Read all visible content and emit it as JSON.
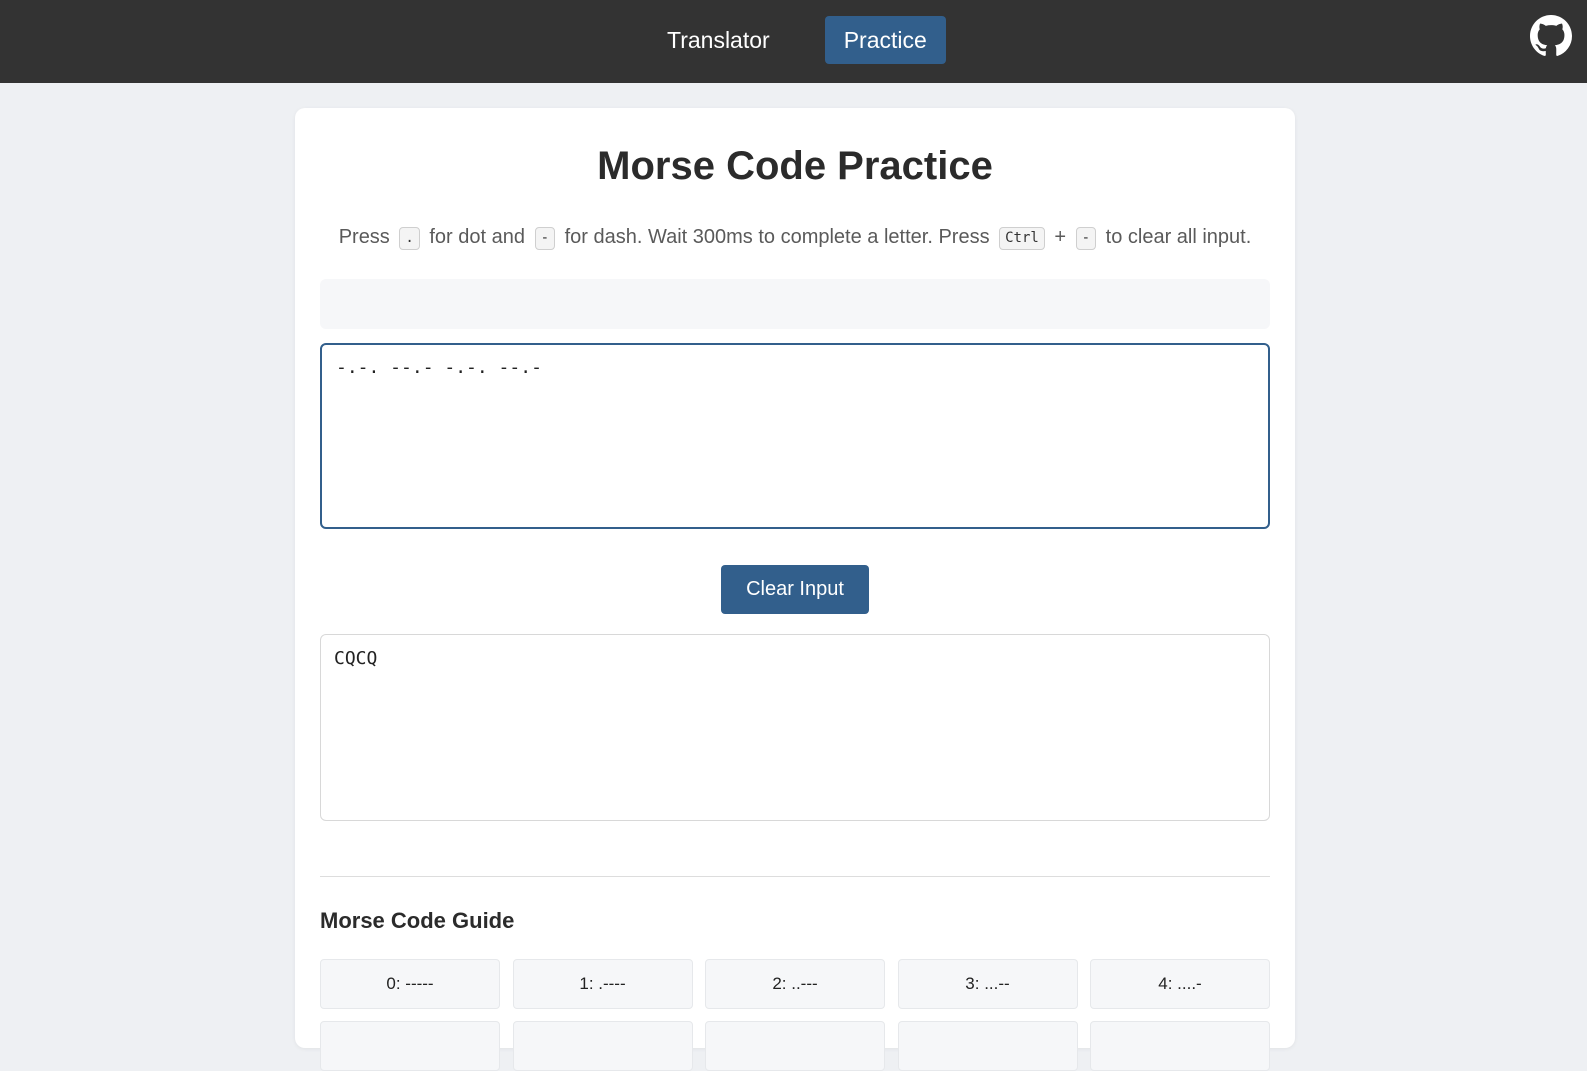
{
  "nav": {
    "items": [
      {
        "label": "Translator",
        "active": false
      },
      {
        "label": "Practice",
        "active": true
      }
    ],
    "github_icon": "github-icon"
  },
  "colors": {
    "topbar": "#333333",
    "accent": "#325f8c",
    "page_bg": "#eef0f3"
  },
  "page": {
    "title": "Morse Code Practice",
    "instructions": {
      "press": "Press",
      "dot_key": ".",
      "for_dot": "for dot and",
      "dash_key": "-",
      "for_dash": "for dash. Wait 300ms to complete a letter. Press",
      "ctrl_key": "Ctrl",
      "plus": "+",
      "clear_key": "-",
      "to_clear": "to clear all input."
    },
    "display_text": "",
    "morse_input_value": "-.-. --.- -.-. --.-",
    "clear_button_label": "Clear Input",
    "output_value": "CQCQ"
  },
  "guide": {
    "title": "Morse Code Guide",
    "entries": [
      "0: -----",
      "1: .----",
      "2: ..---",
      "3: ...--",
      "4: ....-",
      "",
      "",
      "",
      "",
      ""
    ]
  }
}
